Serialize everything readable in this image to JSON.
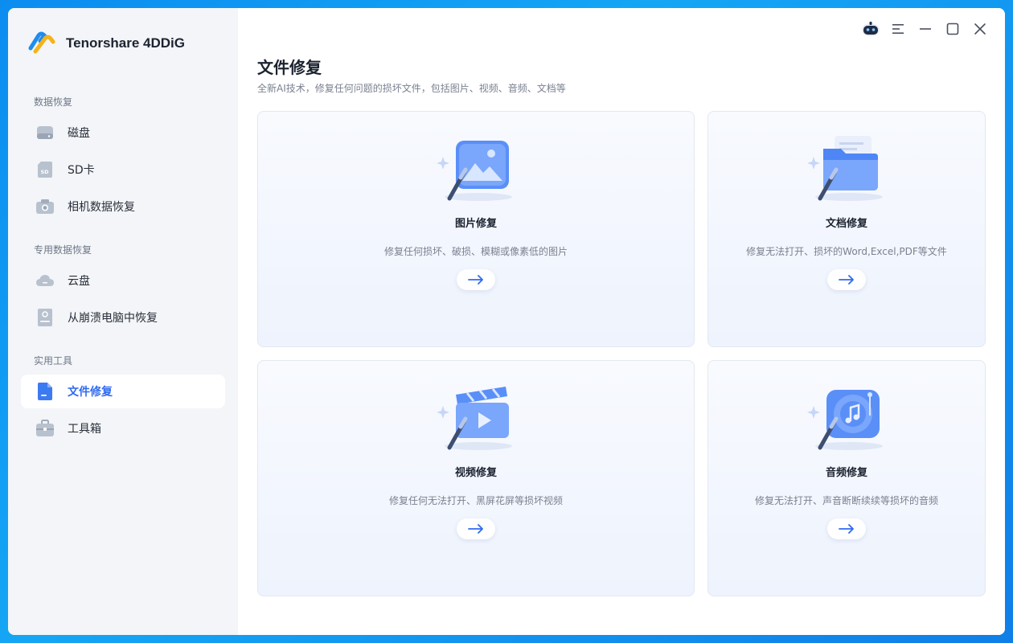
{
  "app": {
    "name": "Tenorshare 4DDiG"
  },
  "sidebar": {
    "sections": [
      {
        "title": "数据恢复",
        "items": [
          {
            "label": "磁盘",
            "icon": "disk-icon"
          },
          {
            "label": "SD卡",
            "icon": "sd-card-icon"
          },
          {
            "label": "相机数据恢复",
            "icon": "camera-icon"
          }
        ]
      },
      {
        "title": "专用数据恢复",
        "items": [
          {
            "label": "云盘",
            "icon": "cloud-icon"
          },
          {
            "label": "从崩溃电脑中恢复",
            "icon": "crashed-pc-icon"
          }
        ]
      },
      {
        "title": "实用工具",
        "items": [
          {
            "label": "文件修复",
            "icon": "file-repair-icon",
            "active": true
          },
          {
            "label": "工具箱",
            "icon": "toolbox-icon"
          }
        ]
      }
    ]
  },
  "titlebar": {
    "buttons": [
      "assistant-bot-icon",
      "menu-icon",
      "minimize-icon",
      "maximize-icon",
      "close-icon"
    ]
  },
  "main": {
    "title": "文件修复",
    "subtitle": "全新AI技术，修复任何问题的损坏文件，包括图片、视频、音频、文档等",
    "cards": [
      {
        "title": "图片修复",
        "desc": "修复任何损坏、破损、模糊或像素低的图片",
        "icon": "photo-repair-icon"
      },
      {
        "title": "文档修复",
        "desc": "修复无法打开、损坏的Word,Excel,PDF等文件",
        "icon": "document-repair-icon"
      },
      {
        "title": "视频修复",
        "desc": "修复任何无法打开、黑屏花屏等损坏视频",
        "icon": "video-repair-icon"
      },
      {
        "title": "音频修复",
        "desc": "修复无法打开、声音断断续续等损坏的音频",
        "icon": "audio-repair-icon"
      }
    ]
  },
  "colors": {
    "accent": "#2f6bf0",
    "sidebar_bg": "#f3f5f8",
    "card_bg": "#f4f7fd"
  }
}
